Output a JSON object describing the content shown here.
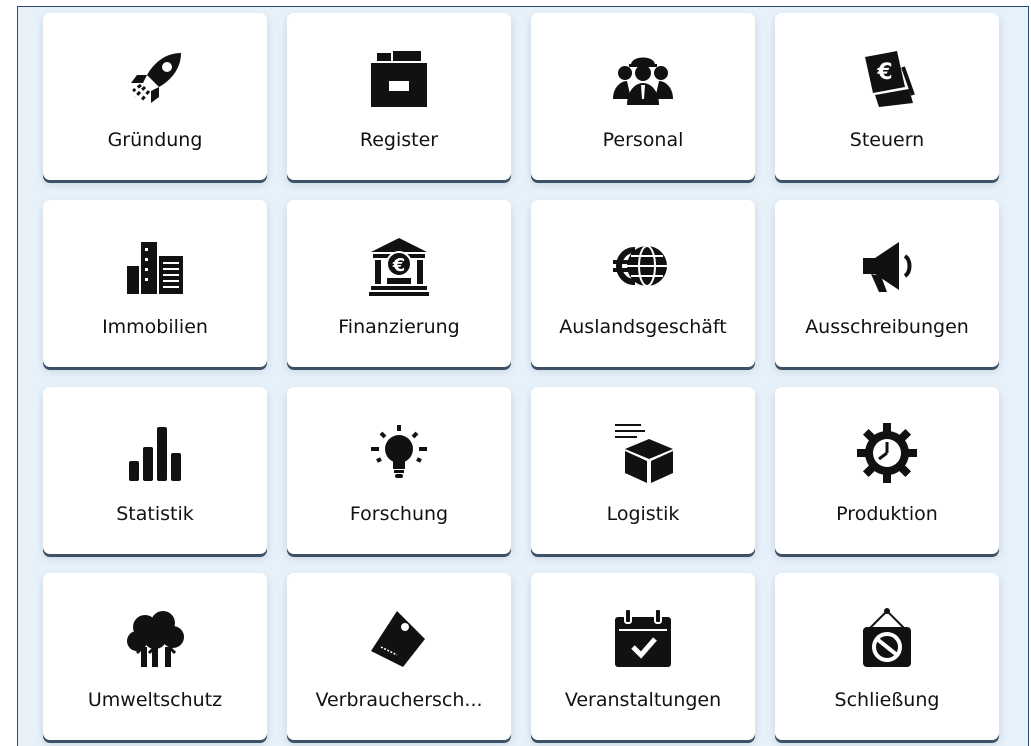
{
  "tiles": [
    {
      "label": "Gründung",
      "icon": "rocket-icon"
    },
    {
      "label": "Register",
      "icon": "archive-box-icon"
    },
    {
      "label": "Personal",
      "icon": "team-icon"
    },
    {
      "label": "Steuern",
      "icon": "euro-bill-icon"
    },
    {
      "label": "Immobilien",
      "icon": "buildings-icon"
    },
    {
      "label": "Finanzierung",
      "icon": "bank-euro-icon"
    },
    {
      "label": "Auslandsgeschäft",
      "icon": "euro-globe-icon"
    },
    {
      "label": "Ausschreibungen",
      "icon": "megaphone-icon"
    },
    {
      "label": "Statistik",
      "icon": "bar-chart-icon"
    },
    {
      "label": "Forschung",
      "icon": "lightbulb-icon"
    },
    {
      "label": "Logistik",
      "icon": "delivery-box-icon"
    },
    {
      "label": "Produktion",
      "icon": "gear-clock-icon"
    },
    {
      "label": "Umweltschutz",
      "icon": "trees-icon"
    },
    {
      "label": "Verbrauchersch...",
      "icon": "price-tag-icon"
    },
    {
      "label": "Veranstaltungen",
      "icon": "calendar-check-icon"
    },
    {
      "label": "Schließung",
      "icon": "closed-sign-icon"
    }
  ],
  "colors": {
    "background": "#e7f1fa",
    "tile": "#ffffff",
    "icon": "#111111",
    "border": "#2c4a73"
  }
}
